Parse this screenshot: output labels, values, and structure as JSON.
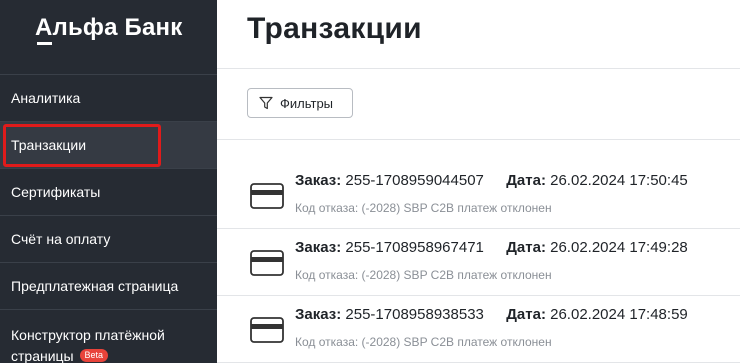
{
  "sidebar": {
    "logo": "Альфа Банк",
    "items": [
      {
        "label": "Аналитика"
      },
      {
        "label": "Транзакции"
      },
      {
        "label": "Сертификаты"
      },
      {
        "label": "Счёт на оплату"
      },
      {
        "label": "Предплатежная страница"
      },
      {
        "label": "Конструктор платёжной страницы",
        "badge": "Beta"
      }
    ],
    "active_index": 1
  },
  "main": {
    "title": "Транзакции",
    "filter_label": "Фильтры",
    "order_label": "Заказ:",
    "date_label": "Дата:",
    "transactions": [
      {
        "order": "255-1708959044507",
        "date": "26.02.2024 17:50:45",
        "reason": "Код отказа: (-2028) SBP C2B платеж отклонен"
      },
      {
        "order": "255-1708958967471",
        "date": "26.02.2024 17:49:28",
        "reason": "Код отказа: (-2028) SBP C2B платеж отклонен"
      },
      {
        "order": "255-1708958938533",
        "date": "26.02.2024 17:48:59",
        "reason": "Код отказа: (-2028) SBP C2B платеж отклонен"
      }
    ]
  },
  "colors": {
    "sidebar_bg": "#262b33",
    "sidebar_active_bg": "#353a43",
    "highlight": "#e01b1b",
    "beta_badge": "#e8433a"
  },
  "icons": {
    "filter": "filter-icon",
    "transaction": "credit-card-icon"
  }
}
